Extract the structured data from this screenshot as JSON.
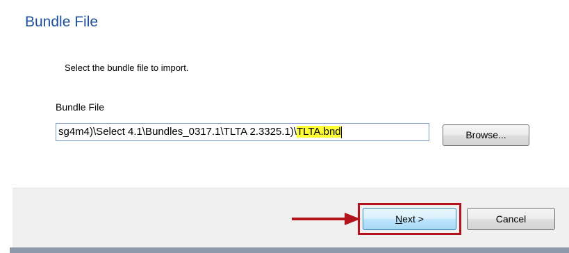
{
  "dialog": {
    "title": "Bundle File",
    "instruction": "Select the bundle file to import.",
    "field_label": "Bundle File",
    "path_prefix": "sg4m4)\\Select 4.1\\Bundles_0317.1\\TLTA 2.3325.1)\\",
    "path_highlight": "TLTA.bnd",
    "browse_label": "Browse...",
    "next_mnemonic": "N",
    "next_rest": "ext >",
    "cancel_label": "Cancel"
  },
  "colors": {
    "title": "#1c4f9c",
    "highlight": "#ffff33",
    "annotation": "#b3131b"
  }
}
